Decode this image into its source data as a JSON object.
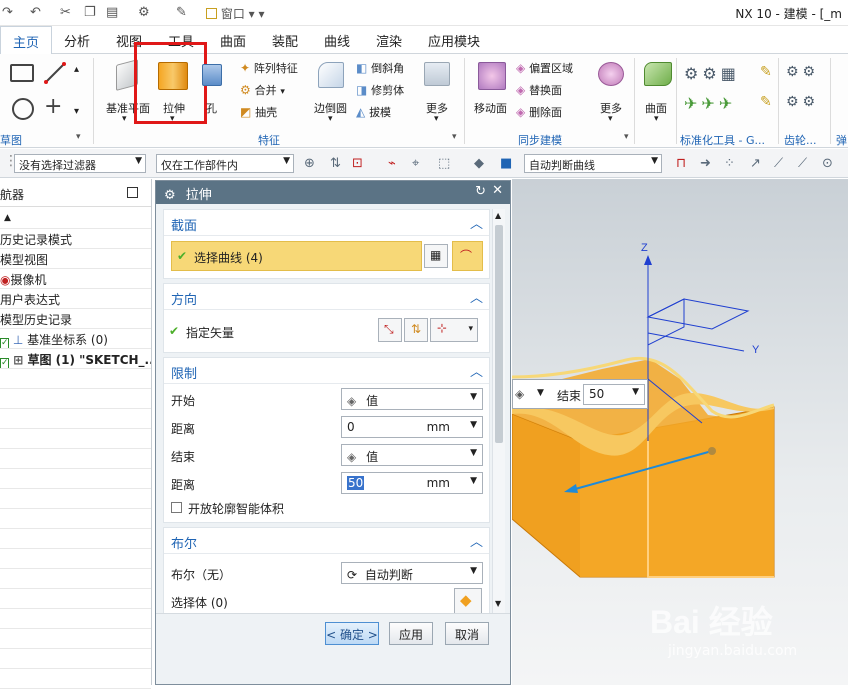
{
  "titlebar": {
    "window_menu": "窗口",
    "app_title": "NX 10 - 建模 - [_m"
  },
  "tabs": [
    "主页",
    "分析",
    "视图",
    "工具",
    "曲面",
    "装配",
    "曲线",
    "渲染",
    "应用模块"
  ],
  "ribbon": {
    "datum_plane": "基准平面",
    "extrude": "拉伸",
    "hole": "孔",
    "pattern_feature": "阵列特征",
    "unite": "合并",
    "shell": "抽壳",
    "edge_blend": "边倒圆",
    "chamfer": "倒斜角",
    "trim_body": "修剪体",
    "draft": "拔模",
    "more": "更多",
    "move_face": "移动面",
    "offset_region": "偏置区域",
    "replace_face": "替换面",
    "delete_face": "删除面",
    "surface": "曲面",
    "groups": {
      "sketch": "草图",
      "feature": "特征",
      "sync_modeling": "同步建模",
      "standard_tools": "标准化工具 - G...",
      "gear": "齿轮...",
      "spring": "弹"
    }
  },
  "toolbar": {
    "filter": "没有选择过滤器",
    "scope": "仅在工作部件内",
    "curve_rule": "自动判断曲线"
  },
  "navigator": {
    "title": "航器",
    "items": [
      "历史记录模式",
      "模型视图",
      "摄像机",
      "用户表达式",
      "模型历史记录",
      "基准坐标系 (0)",
      "草图 (1) \"SKETCH_..."
    ]
  },
  "dialog": {
    "title": "拉伸",
    "section": {
      "title": "截面",
      "select_curve": "选择曲线 (4)"
    },
    "direction": {
      "title": "方向",
      "specify_vector": "指定矢量"
    },
    "limits": {
      "title": "限制",
      "start_label": "开始",
      "start_value": "值",
      "distance_label": "距离",
      "start_distance": "0",
      "unit": "mm",
      "end_label": "结束",
      "end_value": "值",
      "end_distance": "50",
      "open_profile": "开放轮廓智能体积"
    },
    "boolean": {
      "title": "布尔",
      "label": "布尔（无）",
      "value": "自动判断",
      "select_body": "选择体 (0)"
    },
    "buttons": {
      "ok": "< 确定 >",
      "apply": "应用",
      "cancel": "取消"
    }
  },
  "viewport": {
    "end_label": "结束",
    "end_value": "50",
    "axis_z": "Z",
    "axis_y": "Y"
  },
  "watermark": {
    "logo": "Bai 经验",
    "url": "jingyan.baidu.com"
  },
  "colors": {
    "accent": "#1f64b4",
    "highlight_red": "#e01818",
    "selection_yellow": "#f7d877",
    "model_orange": "#f5a623",
    "dialog_title": "#5b7385"
  }
}
